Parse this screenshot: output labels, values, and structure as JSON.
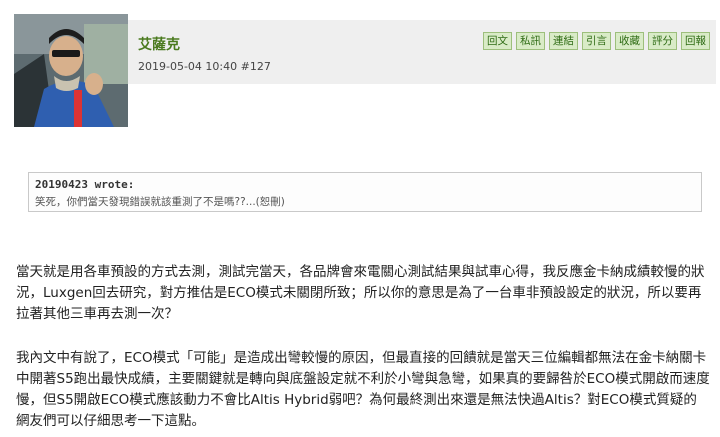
{
  "post": {
    "username": "艾薩克",
    "timestamp": "2019-05-04 10:40",
    "post_number": "#127"
  },
  "actions": [
    "回文",
    "私訊",
    "連結",
    "引言",
    "收藏",
    "評分",
    "回報"
  ],
  "quote": {
    "author": "20190423 wrote:",
    "text": "笑死，你們當天發現錯誤就該重測了不是嗎??...(恕刪)"
  },
  "body": {
    "paragraph1": "當天就是用各車預設的方式去測，測試完當天，各品牌會來電關心測試結果與試車心得，我反應金卡納成績較慢的狀況，Luxgen回去研究，對方推估是ECO模式未關閉所致；所以你的意思是為了一台車非預設設定的狀況，所以要再拉著其他三車再去測一次？",
    "paragraph2": "我內文中有說了，ECO模式「可能」是造成出彎較慢的原因，但最直接的回饋就是當天三位編輯都無法在金卡納關卡中開著S5跑出最快成績，主要關鍵就是轉向與底盤設定就不利於小彎與急彎，如果真的要歸咎於ECO模式開啟而速度慢，但S5開啟ECO模式應該動力不會比Altis Hybrid弱吧？為何最終測出來還是無法快過Altis？對ECO模式質疑的網友們可以仔細思考一下這點。"
  }
}
